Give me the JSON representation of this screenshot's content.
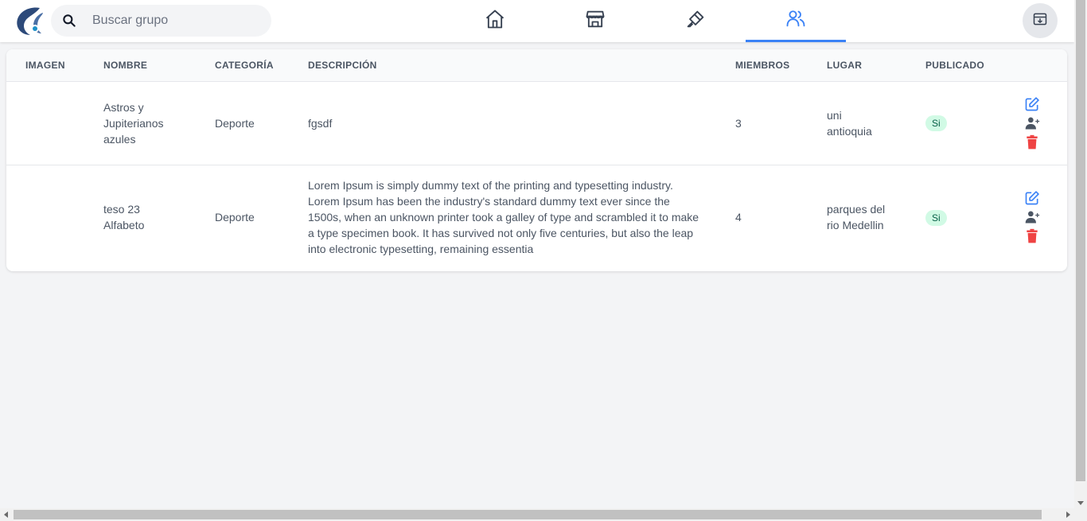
{
  "header": {
    "search": {
      "placeholder": "Buscar grupo",
      "value": ""
    },
    "nav": [
      {
        "name": "home",
        "icon": "home-icon",
        "active": false
      },
      {
        "name": "store",
        "icon": "store-icon",
        "active": false
      },
      {
        "name": "brush",
        "icon": "brush-icon",
        "active": false
      },
      {
        "name": "groups",
        "icon": "users-icon",
        "active": true
      }
    ],
    "archive_icon": "archive-icon"
  },
  "table": {
    "columns": [
      "IMAGEN",
      "NOMBRE",
      "CATEGORÍA",
      "DESCRIPCIÓN",
      "MIEMBROS",
      "LUGAR",
      "PUBLICADO"
    ],
    "rows": [
      {
        "imagen": "",
        "nombre": "Astros y Jupiterianos azules",
        "categoria": "Deporte",
        "descripcion": "fgsdf",
        "miembros": "3",
        "lugar": "uni antioquia",
        "publicado": "Si"
      },
      {
        "imagen": "",
        "nombre": "teso 23 Alfabeto",
        "categoria": "Deporte",
        "descripcion": "Lorem Ipsum is simply dummy text of the printing and typesetting industry. Lorem Ipsum has been the industry's standard dummy text ever since the 1500s, when an unknown printer took a galley of type and scrambled it to make a type specimen book. It has survived not only five centuries, but also the leap into electronic typesetting, remaining essentia",
        "miembros": "4",
        "lugar": "parques del rio Medellin",
        "publicado": "Si"
      }
    ]
  },
  "colors": {
    "accent": "#3b82f6",
    "edit": "#3b82f6",
    "members": "#4b5563",
    "delete": "#ef4444",
    "badge_bg": "#d1fae5",
    "badge_text": "#065f46"
  }
}
